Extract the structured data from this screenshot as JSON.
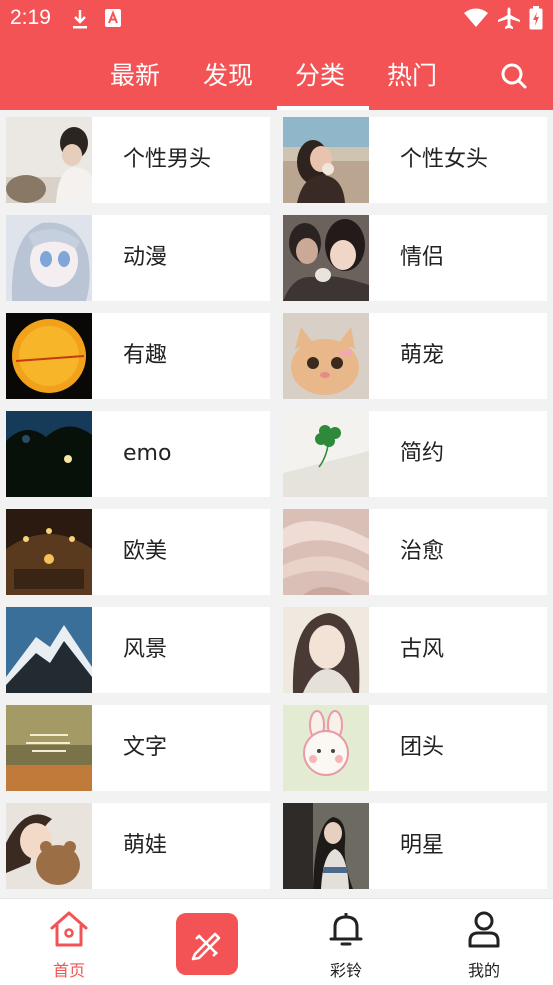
{
  "status": {
    "time": "2:19"
  },
  "tabs": [
    {
      "label": "最新"
    },
    {
      "label": "发现"
    },
    {
      "label": "分类"
    },
    {
      "label": "热门"
    }
  ],
  "categories": [
    {
      "label": "个性男头"
    },
    {
      "label": "个性女头"
    },
    {
      "label": "动漫"
    },
    {
      "label": "情侣"
    },
    {
      "label": "有趣"
    },
    {
      "label": "萌宠"
    },
    {
      "label": "emo"
    },
    {
      "label": "简约"
    },
    {
      "label": "欧美"
    },
    {
      "label": "治愈"
    },
    {
      "label": "风景"
    },
    {
      "label": "古风"
    },
    {
      "label": "文字"
    },
    {
      "label": "团头"
    },
    {
      "label": "萌娃"
    },
    {
      "label": "明星"
    }
  ],
  "bottom_nav": {
    "home": "首页",
    "ringtone": "彩铃",
    "mine": "我的"
  },
  "colors": {
    "accent": "#f45355"
  },
  "icons": [
    "download-icon",
    "app-store-icon",
    "wifi-icon",
    "airplane-icon",
    "battery-icon",
    "search-icon",
    "home-icon",
    "edit-tools-icon",
    "bell-icon",
    "user-icon"
  ]
}
